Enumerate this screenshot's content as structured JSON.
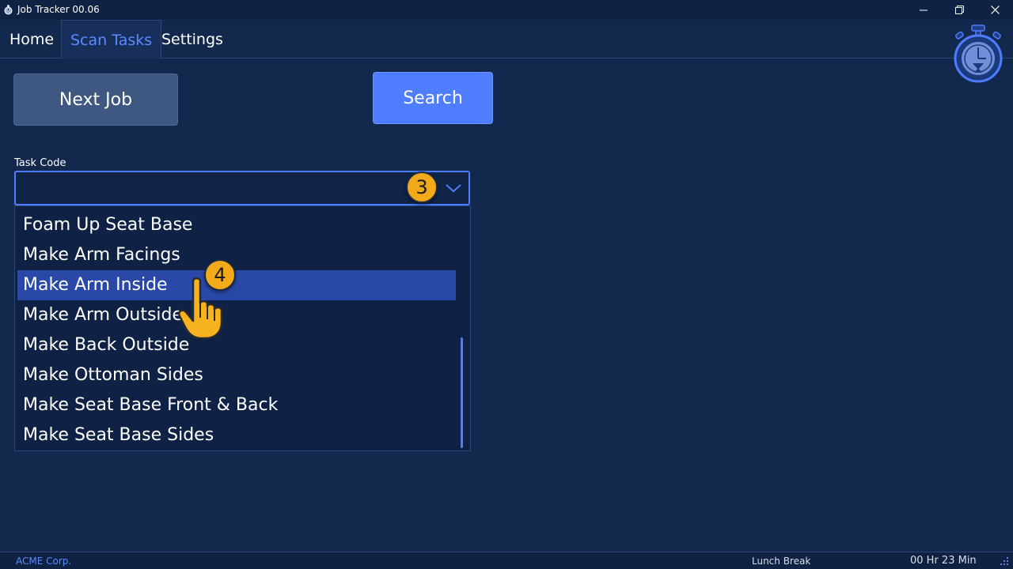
{
  "window": {
    "title": "Job Tracker 00.06"
  },
  "tabs": [
    {
      "label": "Home"
    },
    {
      "label": "Scan Tasks"
    },
    {
      "label": "Settings"
    }
  ],
  "buttons": {
    "next_job": "Next Job",
    "search": "Search"
  },
  "task_code": {
    "label": "Task Code",
    "value": ""
  },
  "dropdown": {
    "items": [
      {
        "label": "Foam Up Seat Base"
      },
      {
        "label": "Make Arm Facings"
      },
      {
        "label": "Make Arm Inside"
      },
      {
        "label": "Make Arm Outside"
      },
      {
        "label": "Make Back Outside"
      },
      {
        "label": "Make Ottoman Sides"
      },
      {
        "label": "Make Seat Base Front & Back"
      },
      {
        "label": "Make Seat Base Sides"
      }
    ],
    "selected": "Make Arm Inside"
  },
  "badges": {
    "step_a": "3",
    "step_b": "4"
  },
  "status": {
    "company": "ACME Corp.",
    "state": "Lunch Break",
    "timer": "00 Hr 23 Min"
  },
  "colors": {
    "background": "#13284d",
    "accent": "#4f7dff",
    "active_tab": "#5b8aff",
    "selection": "#2a48a8",
    "badge": "#f2a91a"
  },
  "icons": [
    "app-icon",
    "minimize-icon",
    "restore-icon",
    "close-icon",
    "chevron-down-icon",
    "stopwatch-logo-icon",
    "hand-pointer-icon",
    "resize-grip-icon"
  ]
}
